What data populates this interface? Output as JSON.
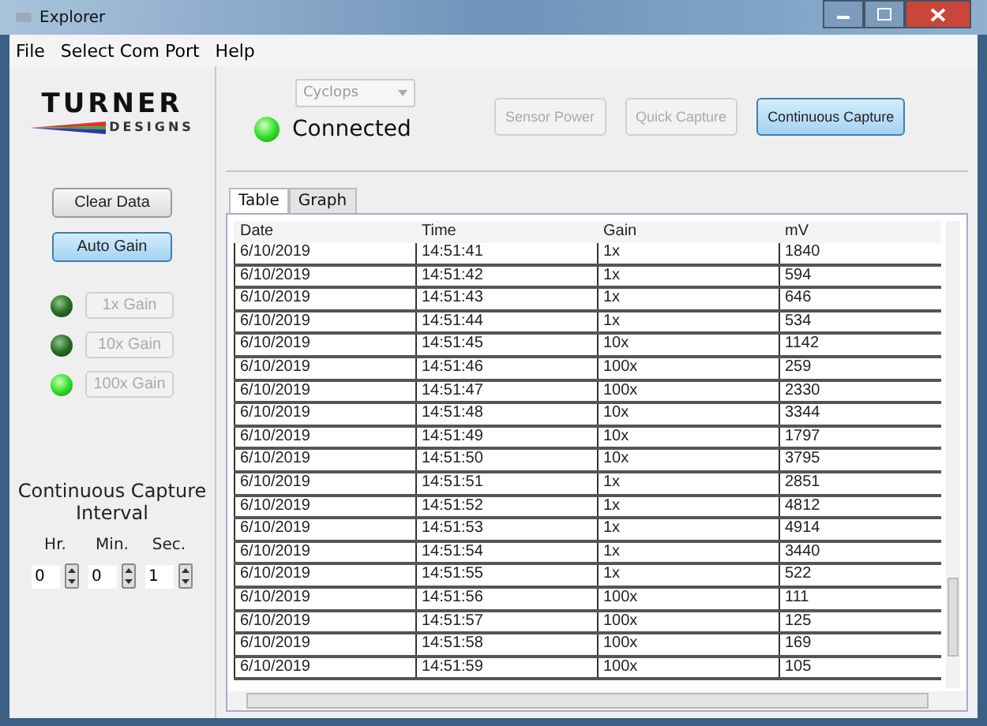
{
  "window": {
    "title": "Explorer"
  },
  "menu": [
    "File",
    "Select Com Port",
    "Help"
  ],
  "logo": {
    "name": "TURNER",
    "sub": "DESIGNS"
  },
  "left_buttons": [
    {
      "label": "Clear Data",
      "active": false
    },
    {
      "label": "Auto Gain",
      "active": true
    }
  ],
  "gains": [
    {
      "label": "1x Gain",
      "on": false,
      "disabled": true
    },
    {
      "label": "10x Gain",
      "on": false,
      "disabled": true
    },
    {
      "label": "100x Gain",
      "on": true,
      "disabled": true
    }
  ],
  "interval": {
    "title": "Continuous Capture Interval",
    "fields": [
      {
        "label": "Hr.",
        "value": "0"
      },
      {
        "label": "Min.",
        "value": "0"
      },
      {
        "label": "Sec.",
        "value": "1"
      }
    ]
  },
  "device": {
    "value": "Cyclops",
    "disabled": true
  },
  "status": {
    "label": "Connected",
    "on": true
  },
  "top_buttons": [
    {
      "label": "Sensor Power",
      "disabled": true,
      "active": false
    },
    {
      "label": "Quick Capture",
      "disabled": true,
      "active": false
    },
    {
      "label": "Continuous Capture",
      "disabled": false,
      "active": true
    }
  ],
  "tabs": [
    {
      "label": "Table",
      "selected": true
    },
    {
      "label": "Graph",
      "selected": false
    }
  ],
  "table": {
    "columns": [
      "Date",
      "Time",
      "Gain",
      "mV"
    ],
    "rows": [
      [
        "6/10/2019",
        "14:51:41",
        "1x",
        "1840"
      ],
      [
        "6/10/2019",
        "14:51:42",
        "1x",
        "594"
      ],
      [
        "6/10/2019",
        "14:51:43",
        "1x",
        "646"
      ],
      [
        "6/10/2019",
        "14:51:44",
        "1x",
        "534"
      ],
      [
        "6/10/2019",
        "14:51:45",
        "10x",
        "1142"
      ],
      [
        "6/10/2019",
        "14:51:46",
        "100x",
        "259"
      ],
      [
        "6/10/2019",
        "14:51:47",
        "100x",
        "2330"
      ],
      [
        "6/10/2019",
        "14:51:48",
        "10x",
        "3344"
      ],
      [
        "6/10/2019",
        "14:51:49",
        "10x",
        "1797"
      ],
      [
        "6/10/2019",
        "14:51:50",
        "10x",
        "3795"
      ],
      [
        "6/10/2019",
        "14:51:51",
        "1x",
        "2851"
      ],
      [
        "6/10/2019",
        "14:51:52",
        "1x",
        "4812"
      ],
      [
        "6/10/2019",
        "14:51:53",
        "1x",
        "4914"
      ],
      [
        "6/10/2019",
        "14:51:54",
        "1x",
        "3440"
      ],
      [
        "6/10/2019",
        "14:51:55",
        "1x",
        "522"
      ],
      [
        "6/10/2019",
        "14:51:56",
        "100x",
        "111"
      ],
      [
        "6/10/2019",
        "14:51:57",
        "100x",
        "125"
      ],
      [
        "6/10/2019",
        "14:51:58",
        "100x",
        "169"
      ],
      [
        "6/10/2019",
        "14:51:59",
        "100x",
        "105"
      ]
    ]
  }
}
